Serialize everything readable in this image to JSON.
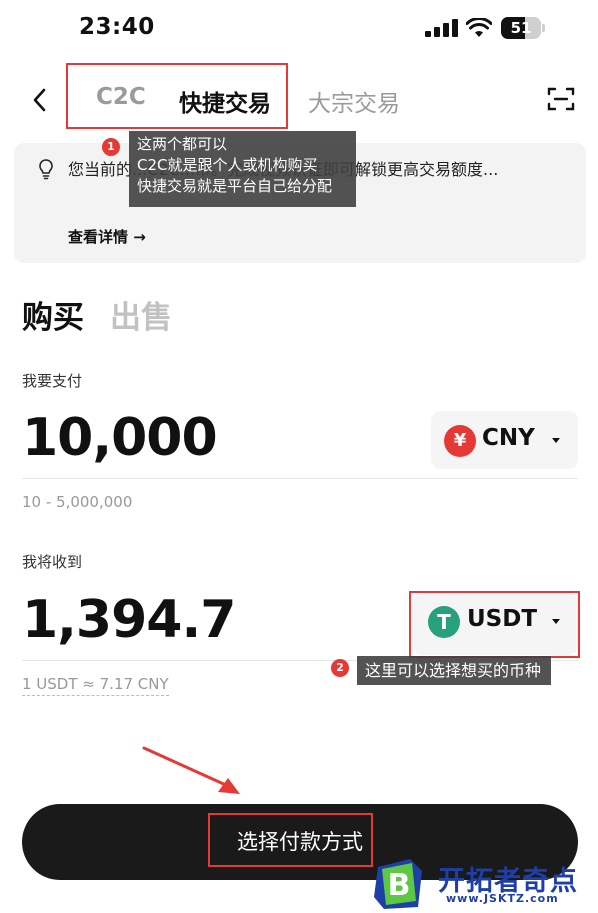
{
  "status_bar": {
    "time": "23:40",
    "battery": "51"
  },
  "nav": {
    "tabs": [
      {
        "label": "C2C"
      },
      {
        "label": "快捷交易"
      },
      {
        "label": "大宗交易"
      }
    ]
  },
  "annotations": {
    "badge1": "1",
    "tip1_line1": "这两个都可以",
    "tip1_line2": "C2C就是跟个人或机构购买",
    "tip1_line3": "快捷交易就是平台自己给分配",
    "badge2": "2",
    "tip2": "这里可以选择想买的币种"
  },
  "notice": {
    "text": "您当前的...C2C...币。完成视频认证即可解锁更高交易额度...",
    "link": "查看详情 →"
  },
  "trade": {
    "buy_label": "购买",
    "sell_label": "出售",
    "pay_label": "我要支付",
    "pay_amount": "10,000",
    "pay_currency": "CNY",
    "pay_currency_symbol": "¥",
    "pay_range": "10 - 5,000,000",
    "receive_label": "我将收到",
    "receive_amount": "1,394.7",
    "receive_currency": "USDT",
    "receive_currency_symbol": "T",
    "rate": "1 USDT ≈ 7.17 CNY"
  },
  "action": {
    "button_label": "选择付款方式"
  },
  "watermark": {
    "name": "开拓者奇点",
    "url": "www.JSKTZ.com",
    "logo_letter": "B"
  },
  "colors": {
    "accent_red": "#e53935",
    "usdt_green": "#26a17b",
    "button_dark": "#1a1a1a",
    "watermark_blue": "#1f3fa8"
  }
}
